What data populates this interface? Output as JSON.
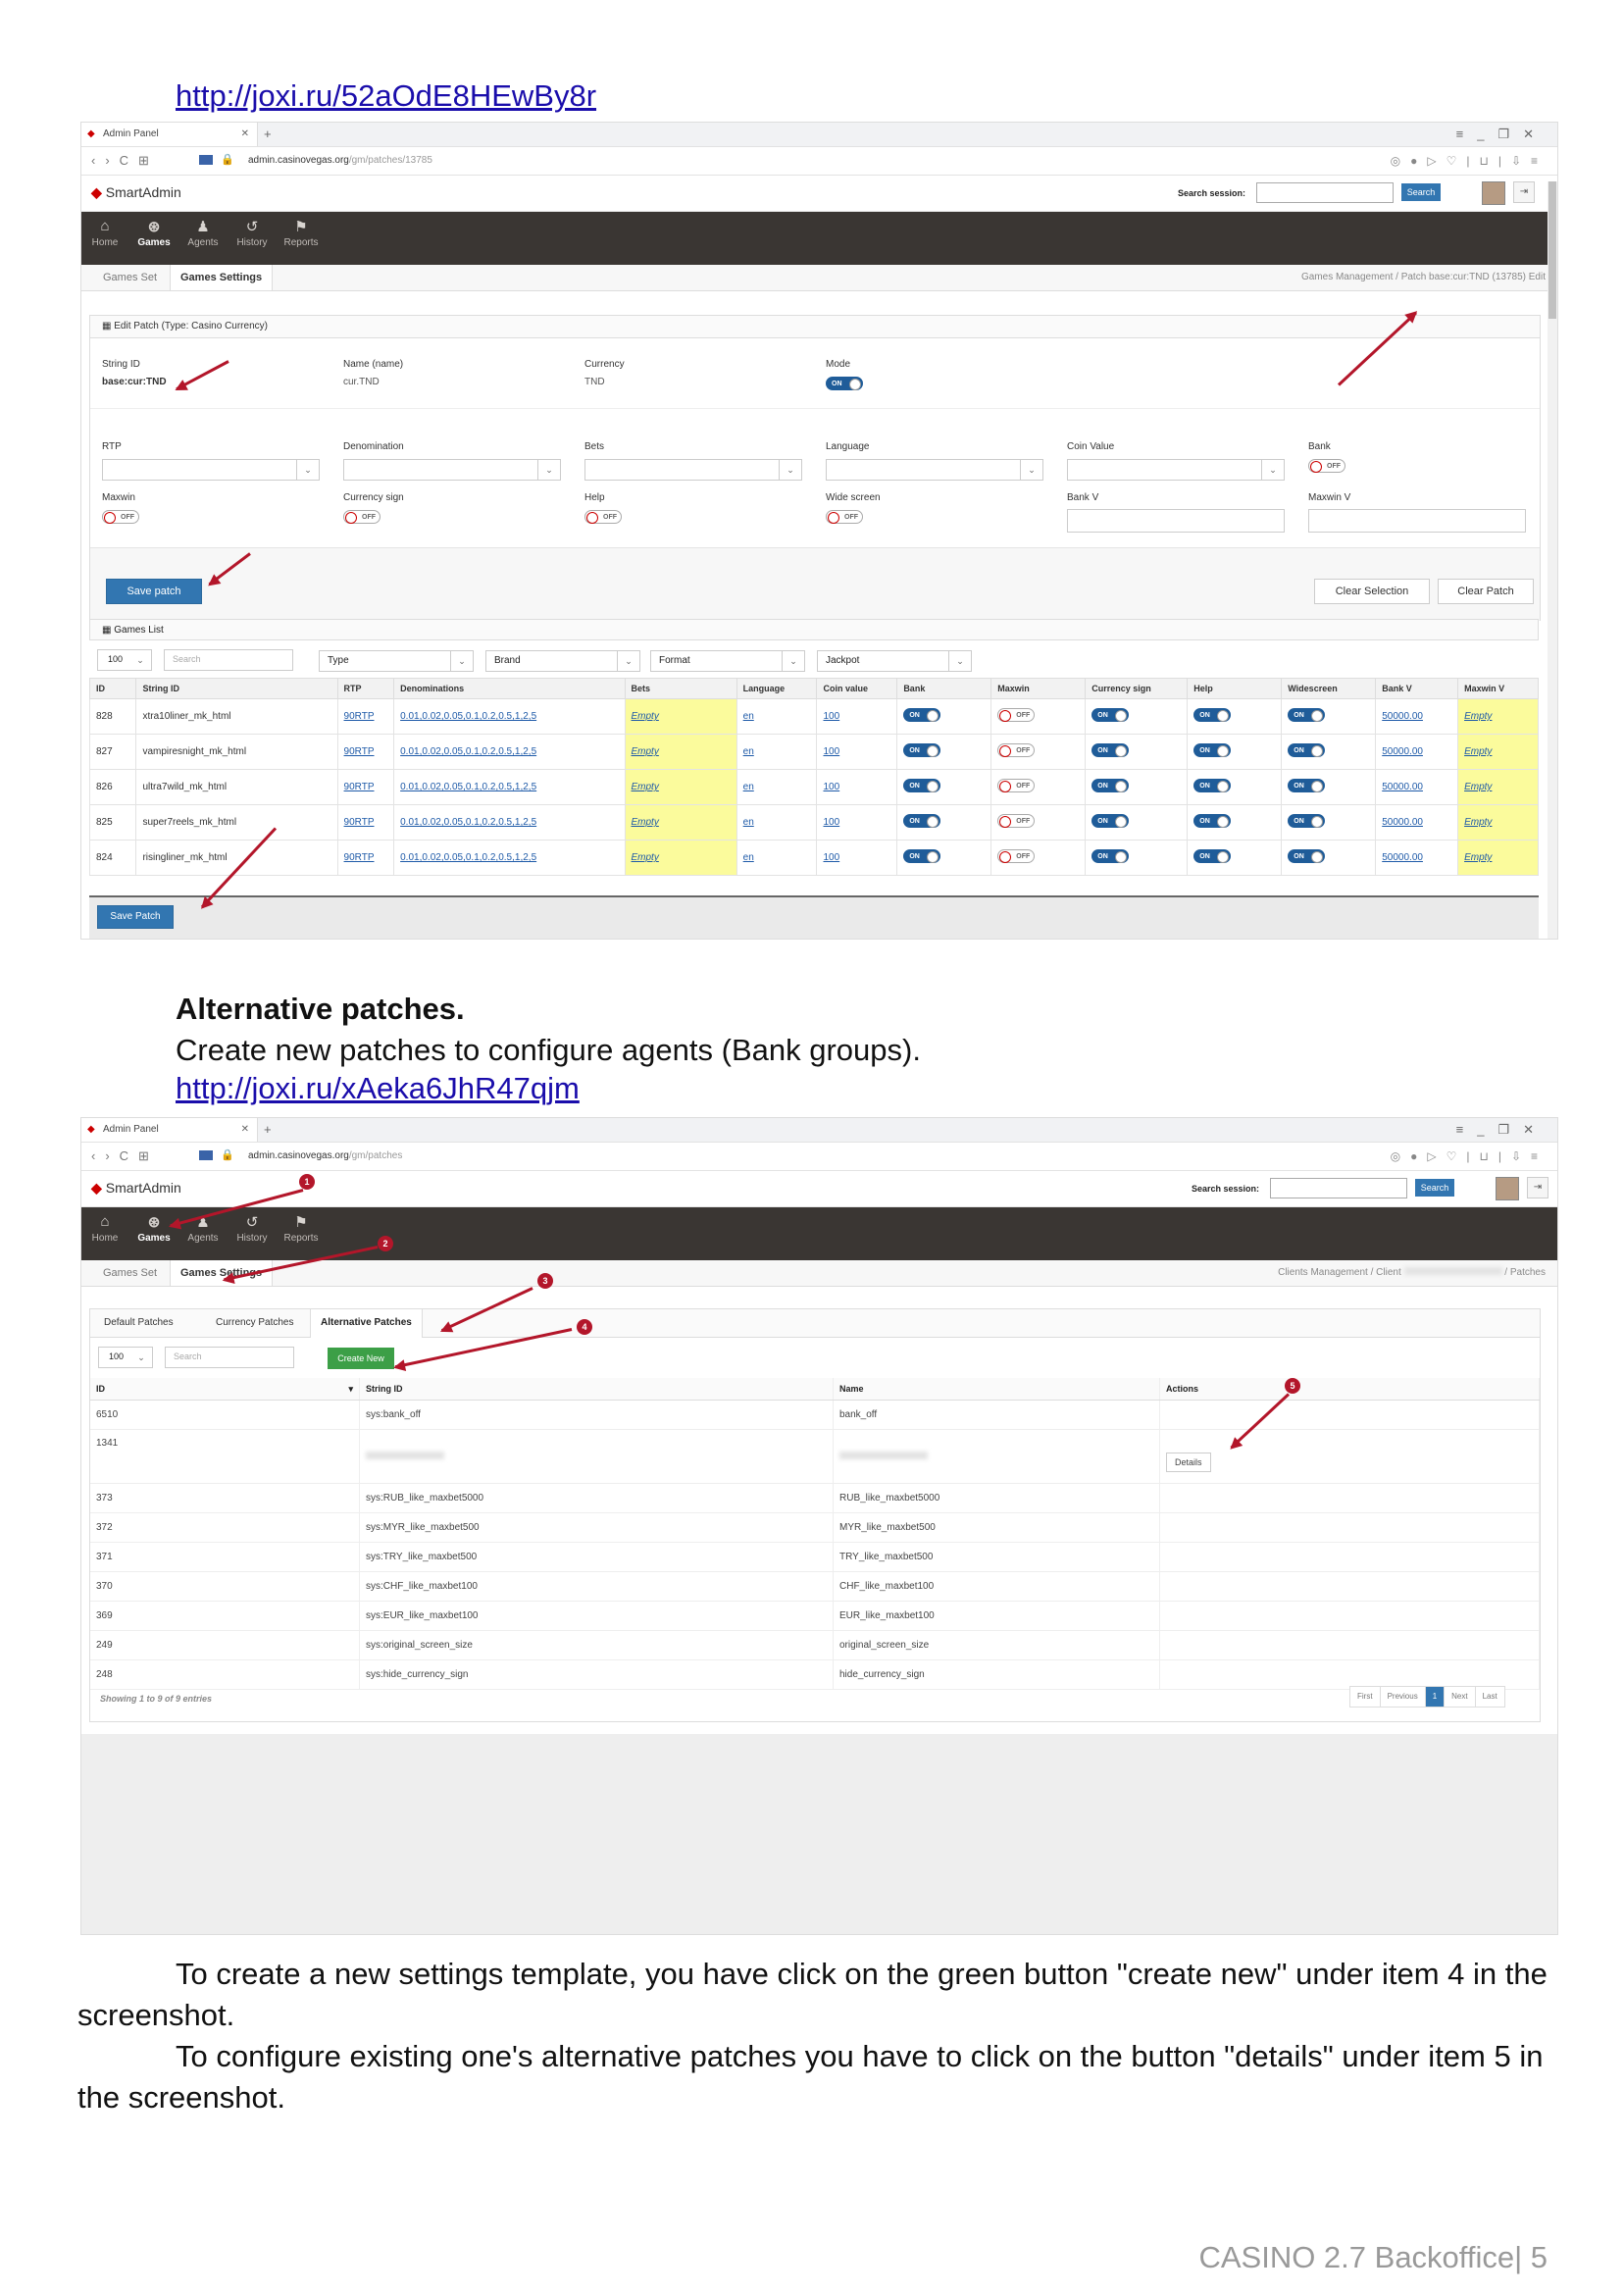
{
  "doc": {
    "link1": "http://joxi.ru/52aOdE8HEwBy8r",
    "heading": "Alternative patches.",
    "subtext": "Create new patches to configure agents (Bank groups).",
    "link2": "http://joxi.ru/xAeka6JhR47qjm",
    "para1_line1": "To create a new settings template, you have click on the green button \"create new\" under item 4 in the",
    "para1_line2": "screenshot.",
    "para2_line1": "To configure existing one's alternative patches you have to click on the button \"details\" under item 5 in",
    "para2_line2": "the screenshot.",
    "footer": "CASINO 2.7 Backoffice| 5"
  },
  "browser": {
    "tab_title": "Admin Panel",
    "url1_host": "admin.casinovegas.org",
    "url1_path": "/gm/patches/13785",
    "url2_host": "admin.casinovegas.org",
    "url2_path": "/gm/patches"
  },
  "app": {
    "logo": "SmartAdmin",
    "search_label": "Search session:",
    "search_btn": "Search",
    "menu": [
      {
        "label": "Home",
        "icon": "home-icon",
        "glyph": "⌂"
      },
      {
        "label": "Games",
        "icon": "gamepad-icon",
        "glyph": "⊛"
      },
      {
        "label": "Agents",
        "icon": "user-icon",
        "glyph": "♟"
      },
      {
        "label": "History",
        "icon": "history-icon",
        "glyph": "↺"
      },
      {
        "label": "Reports",
        "icon": "flag-icon",
        "glyph": "⚑"
      }
    ],
    "subtabs": [
      "Games Set",
      "Games Settings"
    ]
  },
  "shot1": {
    "breadcrumb_1": "Games Management",
    "breadcrumb_2": "Patch base:cur:TND (13785) Edit",
    "panel_title": "Edit Patch (Type: Casino Currency)",
    "string_id_label": "String ID",
    "string_id_value": "base:cur:TND",
    "name_label": "Name (name)",
    "name_value": "cur.TND",
    "currency_label": "Currency",
    "currency_value": "TND",
    "mode_label": "Mode",
    "rtp_label": "RTP",
    "denomination_label": "Denomination",
    "bets_label": "Bets",
    "language_label": "Language",
    "coin_value_label": "Coin Value",
    "bank_label": "Bank",
    "maxwin_label": "Maxwin",
    "currency_sign_label": "Currency sign",
    "help_label": "Help",
    "wide_screen_label": "Wide screen",
    "bank_v_label": "Bank V",
    "maxwin_v_label": "Maxwin V",
    "save_patch": "Save patch",
    "clear_selection": "Clear Selection",
    "clear_patch": "Clear Patch",
    "games_list_title": "Games List",
    "page_size": "100",
    "search_placeholder": "Search",
    "filter_type": "Type",
    "filter_brand": "Brand",
    "filter_format": "Format",
    "filter_jackpot": "Jackpot",
    "columns": [
      "ID",
      "String ID",
      "RTP",
      "Denominations",
      "Bets",
      "Language",
      "Coin value",
      "Bank",
      "Maxwin",
      "Currency sign",
      "Help",
      "Widescreen",
      "Bank V",
      "Maxwin V"
    ],
    "rows": [
      {
        "id": "828",
        "sid": "xtra10liner_mk_html",
        "rtp": "90RTP",
        "den": "0.01,0.02,0.05,0.1,0.2,0.5,1,2,5",
        "bets": "Empty",
        "lang": "en",
        "coin": "100",
        "bankv": "50000.00",
        "maxv": "Empty"
      },
      {
        "id": "827",
        "sid": "vampiresnight_mk_html",
        "rtp": "90RTP",
        "den": "0.01,0.02,0.05,0.1,0.2,0.5,1,2,5",
        "bets": "Empty",
        "lang": "en",
        "coin": "100",
        "bankv": "50000.00",
        "maxv": "Empty"
      },
      {
        "id": "826",
        "sid": "ultra7wild_mk_html",
        "rtp": "90RTP",
        "den": "0.01,0.02,0.05,0.1,0.2,0.5,1,2,5",
        "bets": "Empty",
        "lang": "en",
        "coin": "100",
        "bankv": "50000.00",
        "maxv": "Empty"
      },
      {
        "id": "825",
        "sid": "super7reels_mk_html",
        "rtp": "90RTP",
        "den": "0.01,0.02,0.05,0.1,0.2,0.5,1,2,5",
        "bets": "Empty",
        "lang": "en",
        "coin": "100",
        "bankv": "50000.00",
        "maxv": "Empty"
      },
      {
        "id": "824",
        "sid": "risingliner_mk_html",
        "rtp": "90RTP",
        "den": "0.01,0.02,0.05,0.1,0.2,0.5,1,2,5",
        "bets": "Empty",
        "lang": "en",
        "coin": "100",
        "bankv": "50000.00",
        "maxv": "Empty"
      }
    ],
    "save_patch_bottom": "Save Patch",
    "on_text": "ON",
    "off_text": "OFF"
  },
  "shot2": {
    "breadcrumb_1": "Clients Management",
    "breadcrumb_2": "Client",
    "breadcrumb_3": "Patches",
    "tabs": [
      "Default Patches",
      "Currency Patches",
      "Alternative Patches"
    ],
    "page_size": "100",
    "search_placeholder": "Search",
    "create_new": "Create New",
    "columns": [
      "ID",
      "String ID",
      "Name",
      "Actions"
    ],
    "rows": [
      {
        "id": "6510",
        "sid": "sys:bank_off",
        "name": "bank_off"
      },
      {
        "id": "1341",
        "sid": "",
        "name": ""
      },
      {
        "id": "373",
        "sid": "sys:RUB_like_maxbet5000",
        "name": "RUB_like_maxbet5000"
      },
      {
        "id": "372",
        "sid": "sys:MYR_like_maxbet500",
        "name": "MYR_like_maxbet500"
      },
      {
        "id": "371",
        "sid": "sys:TRY_like_maxbet500",
        "name": "TRY_like_maxbet500"
      },
      {
        "id": "370",
        "sid": "sys:CHF_like_maxbet100",
        "name": "CHF_like_maxbet100"
      },
      {
        "id": "369",
        "sid": "sys:EUR_like_maxbet100",
        "name": "EUR_like_maxbet100"
      },
      {
        "id": "249",
        "sid": "sys:original_screen_size",
        "name": "original_screen_size"
      },
      {
        "id": "248",
        "sid": "sys:hide_currency_sign",
        "name": "hide_currency_sign"
      }
    ],
    "details": "Details",
    "showing": "Showing 1 to 9 of 9 entries",
    "pager": [
      "First",
      "Previous",
      "1",
      "Next",
      "Last"
    ],
    "badges": [
      "1",
      "2",
      "3",
      "4",
      "5"
    ]
  },
  "colors": {
    "arrow": "#b3162a",
    "primary": "#3276b1",
    "green": "#3c9f47",
    "menu_bg": "#3a3633",
    "highlight": "#fbfb9c"
  }
}
